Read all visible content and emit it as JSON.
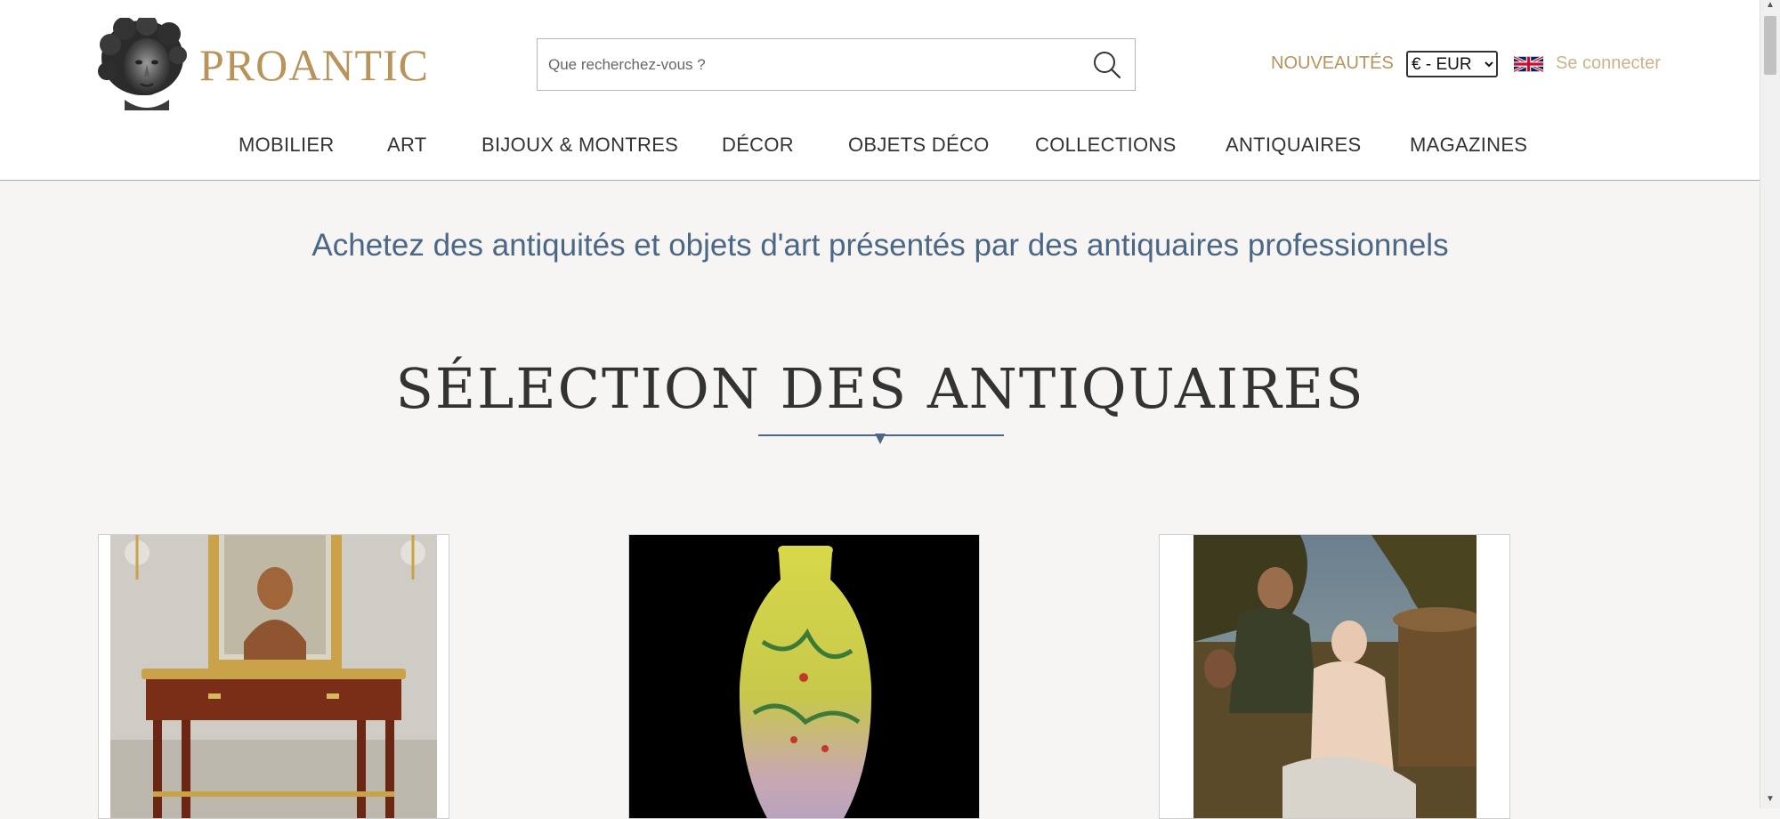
{
  "brand": {
    "name": "PROANTIC"
  },
  "search": {
    "placeholder": "Que recherchez-vous ?"
  },
  "header_links": {
    "new_label": "NOUVEAUTÉS",
    "currency_selected": "€ - EUR",
    "login_label": "Se connecter"
  },
  "nav": {
    "items": [
      {
        "label": "MOBILIER"
      },
      {
        "label": "ART"
      },
      {
        "label": "BIJOUX & MONTRES"
      },
      {
        "label": "DÉCOR"
      },
      {
        "label": "OBJETS DÉCO"
      },
      {
        "label": "COLLECTIONS"
      },
      {
        "label": "ANTIQUAIRES"
      },
      {
        "label": "MAGAZINES"
      }
    ]
  },
  "main": {
    "tagline": "Achetez des antiquités et objets d'art présentés par des antiquaires professionnels",
    "section_title": "SÉLECTION DES ANTIQUAIRES"
  },
  "colors": {
    "brand_gold": "#b8935a",
    "accent_blue": "#4b6786",
    "background": "#f6f5f3"
  },
  "icons": {
    "search": "search-icon",
    "flag": "uk-flag-icon"
  }
}
